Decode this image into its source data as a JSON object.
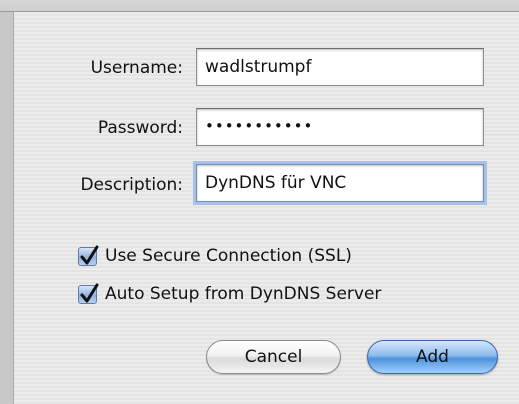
{
  "form": {
    "username": {
      "label": "Username:",
      "value": "wadlstrumpf"
    },
    "password": {
      "label": "Password:",
      "value": "•••••••••••"
    },
    "description": {
      "label": "Description:",
      "value": "DynDNS für VNC"
    }
  },
  "options": [
    {
      "label": "Use Secure Connection (SSL)",
      "checked": true
    },
    {
      "label": "Auto Setup from DynDNS Server",
      "checked": true
    }
  ],
  "buttons": {
    "cancel": "Cancel",
    "add": "Add"
  },
  "colors": {
    "accent": "#4e93de",
    "focus_ring": "#a9c1e6"
  }
}
